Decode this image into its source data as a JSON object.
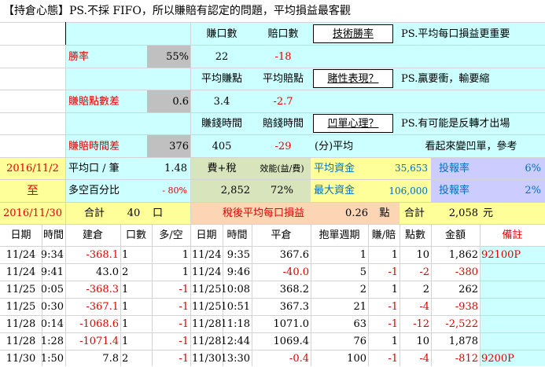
{
  "title": "【持倉心態】PS.不採 FIFO，所以賺賠有認定的問題，平均損益最客觀",
  "stats": {
    "head_earn_count": "賺口數",
    "head_loss_count": "賠口數",
    "tech_win_rate_link": "技術勝率",
    "note1": "PS.平均每口損益更重要",
    "win_rate_label": "勝率",
    "win_rate_value": "55%",
    "earn_count": "22",
    "loss_count": "-18",
    "head_avg_earn_pts": "平均賺點",
    "head_avg_loss_pts": "平均賠點",
    "gambling_link": "賭性表現？",
    "note2": "PS.贏要衝，輸要縮",
    "ratio_label": "賺賠點數差",
    "ratio_value": "0.6",
    "avg_earn_pts": "3.4",
    "avg_loss_pts": "-2.7",
    "head_earn_time": "賺錢時間",
    "head_loss_time": "賠錢時間",
    "concave_link": "凹單心理？",
    "note3": "PS.有可能是反轉才出場",
    "time_diff_label": "賺賠時間差",
    "time_diff_value": "376",
    "earn_time": "405",
    "loss_time": "-29",
    "unit_avg": "(分)平均",
    "note4": "看起來變凹單，參考",
    "date_from": "2016/11/2",
    "date_to_word": "至",
    "date_to": "2016/11/30",
    "avg_per_trade_label": "平均口 / 筆",
    "avg_per_trade_value": "1.48",
    "long_short_label": "多空百分比",
    "long_short_value": "- 80%",
    "fee_tax_label": "費+稅",
    "fee_tax_value": "2,852",
    "efficiency_label": "效能(益/費)",
    "efficiency_value": "72%",
    "avg_capital_label": "平均資金",
    "avg_capital_value": "35,653",
    "max_capital_label": "最大資金",
    "max_capital_value": "106,000",
    "roi_label1": "投報率",
    "roi_value1": "6%",
    "roi_label2": "投報率",
    "roi_value2": "2%",
    "total_label": "合計",
    "total_lots": "40",
    "lot_unit": "口",
    "after_tax_label": "稅後平均每口損益",
    "after_tax_value": "0.26",
    "pts_unit": "點",
    "total_label2": "合計",
    "total_amount": "2,058",
    "currency": "元"
  },
  "table": {
    "headers": [
      "日期",
      "時間",
      "建倉",
      "口數",
      "多/空",
      "日期",
      "時間",
      "平倉",
      "抱單週期",
      "賺/賠",
      "點數",
      "金額",
      "備註"
    ],
    "rows": [
      [
        "11/24",
        "9:34",
        "-368.1",
        "1",
        "1",
        "11/24",
        "9:35",
        "367.6",
        "1",
        "1",
        "10",
        "1,862",
        "92100P"
      ],
      [
        "11/24",
        "9:41",
        "43.0",
        "2",
        "1",
        "11/24",
        "9:46",
        "-40.0",
        "5",
        "-1",
        "-2",
        "-380",
        ""
      ],
      [
        "11/25",
        "10:05",
        "-368.3",
        "1",
        "-1",
        "11/25",
        "10:08",
        "368.2",
        "2",
        "1",
        "2",
        "262",
        ""
      ],
      [
        "11/25",
        "10:30",
        "-367.1",
        "1",
        "-1",
        "11/25",
        "10:51",
        "367.3",
        "21",
        "-1",
        "-4",
        "-938",
        ""
      ],
      [
        "11/28",
        "10:14",
        "-1068.6",
        "1",
        "-1",
        "11/28",
        "11:18",
        "1071.0",
        "63",
        "-1",
        "-12",
        "-2,522",
        ""
      ],
      [
        "11/28",
        "11:28",
        "-1071.4",
        "1",
        "-1",
        "11/28",
        "12:44",
        "1069.4",
        "76",
        "1",
        "10",
        "1,878",
        ""
      ],
      [
        "11/30",
        "11:50",
        "7.8",
        "2",
        "-1",
        "11/30",
        "13:30",
        "-0.4",
        "100",
        "-1",
        "-4",
        "-812",
        "9200P"
      ]
    ]
  },
  "colors": {
    "cyan": "#ccffff",
    "gray": "#c0c0c0",
    "yellow": "#ffff99",
    "orange": "#fcd5b4",
    "green": "#d8e4bc",
    "lavender": "#ccccff",
    "red": "#e00000"
  }
}
